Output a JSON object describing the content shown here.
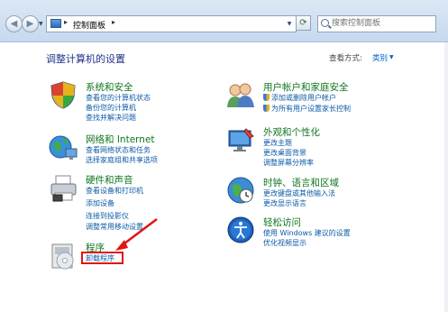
{
  "toolbar": {
    "breadcrumb": "控制面板",
    "separator": "▸",
    "search_placeholder": "搜索控制面板"
  },
  "content": {
    "title": "调整计算机的设置",
    "view_by_label": "查看方式:",
    "view_by_value": "类别"
  },
  "categories": [
    {
      "title": "系统和安全",
      "links": [
        "查看您的计算机状态",
        "备份您的计算机",
        "查找并解决问题"
      ]
    },
    {
      "title": "网络和 Internet",
      "links": [
        "查看网络状态和任务",
        "选择家庭组和共享选项"
      ]
    },
    {
      "title": "硬件和声音",
      "links": [
        "查看设备和打印机",
        "添加设备",
        "连接到投影仪",
        "调整常用移动设置"
      ]
    },
    {
      "title": "程序",
      "links": [
        "卸载程序"
      ]
    },
    {
      "title": "用户帐户和家庭安全",
      "links": [
        "添加或删除用户帐户",
        "为所有用户设置家长控制"
      ]
    },
    {
      "title": "外观和个性化",
      "links": [
        "更改主题",
        "更改桌面背景",
        "调整屏幕分辨率"
      ]
    },
    {
      "title": "时钟、语言和区域",
      "links": [
        "更改键盘或其他输入法",
        "更改显示语言"
      ]
    },
    {
      "title": "轻松访问",
      "links": [
        "使用 Windows 建议的设置",
        "优化视频显示"
      ]
    }
  ],
  "colors": {
    "category_title": "#10751e",
    "link": "#0c5aa6",
    "highlight_box": "#e01414",
    "arrow": "#e01414"
  }
}
